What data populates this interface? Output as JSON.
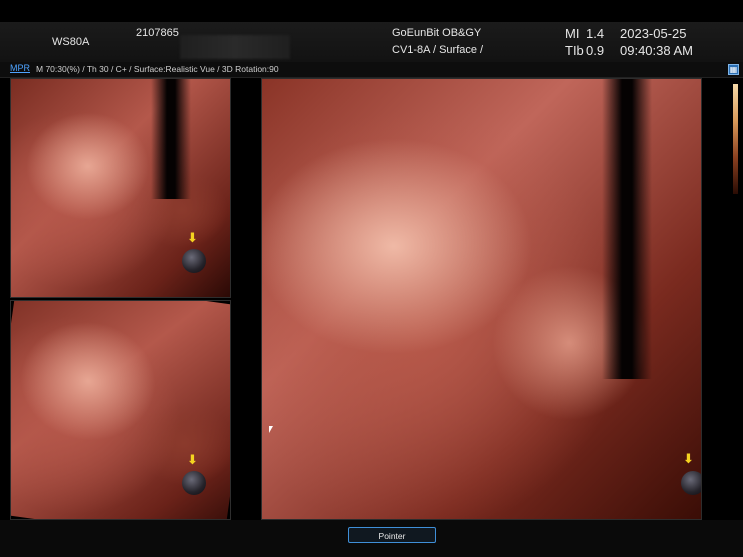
{
  "header": {
    "device": "WS80A",
    "patient_id": "2107865",
    "institution": "GoEunBit OB&GY",
    "probe_mode": "CV1-8A / Surface /",
    "mi_label": "MI",
    "mi_value": "1.4",
    "tib_label": "TIb",
    "tib_value": "0.9",
    "date": "2023-05-25",
    "time": "09:40:38 AM"
  },
  "info_bar": {
    "mode_label": "MPR",
    "params": "M 70:30(%) / Th 30 / C+ / Surface:Realistic Vue / 3D Rotation:90"
  },
  "colors": {
    "accent": "#4ea3ff",
    "marker_arrow": "#f4d320"
  },
  "views": [
    {
      "name": "top-left-view",
      "marker_icon": "sphere-marker-icon"
    },
    {
      "name": "bottom-left-view",
      "marker_icon": "sphere-marker-icon"
    },
    {
      "name": "main-3d-view",
      "marker_icon": "sphere-marker-icon"
    }
  ],
  "footer": {
    "pointer_button": "Pointer"
  }
}
